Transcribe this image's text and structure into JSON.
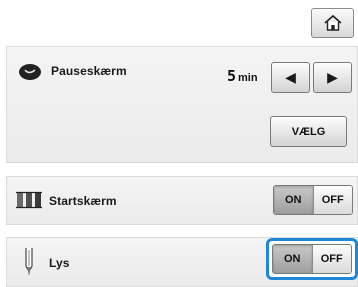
{
  "header": {
    "home_icon": "home-icon"
  },
  "screensaver": {
    "icon": "moon-icon",
    "label": "Pauseskærm",
    "value": "5",
    "unit": "min",
    "prev_icon": "triangle-left-icon",
    "next_icon": "triangle-right-icon",
    "select_label": "VÆLG"
  },
  "startup": {
    "icon": "thread-spools-icon",
    "label": "Startskærm",
    "on_label": "ON",
    "off_label": "OFF",
    "state": "on"
  },
  "light": {
    "icon": "needle-icon",
    "label": "Lys",
    "on_label": "ON",
    "off_label": "OFF",
    "state": "on"
  },
  "colors": {
    "highlight": "#1e88d6",
    "panel": "#efefef"
  }
}
